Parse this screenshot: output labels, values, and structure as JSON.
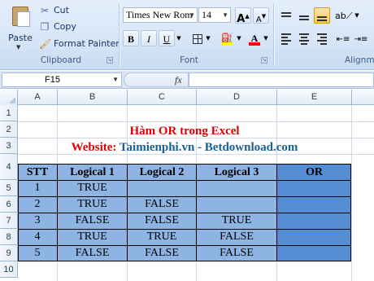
{
  "ribbon": {
    "clipboard": {
      "paste_label": "Paste",
      "cut_label": "Cut",
      "copy_label": "Copy",
      "format_painter_label": "Format Painter",
      "group_title": "Clipboard"
    },
    "font": {
      "font_name": "Times New Rom",
      "font_size": "14",
      "bold_label": "B",
      "italic_label": "I",
      "underline_label": "U",
      "font_color_label": "A",
      "grow_label": "A",
      "shrink_label": "A",
      "group_title": "Font",
      "highlight_color": "#ffff00",
      "font_color": "#ff0000"
    },
    "alignment": {
      "group_title": "Alignme"
    }
  },
  "formula_bar": {
    "name_box": "F15",
    "fx_label": "fx",
    "formula": ""
  },
  "sheet": {
    "columns": [
      "A",
      "B",
      "C",
      "D",
      "E"
    ],
    "rows": [
      "1",
      "2",
      "3",
      "4",
      "5",
      "6",
      "7",
      "8",
      "9",
      "10"
    ],
    "title": "Hàm OR trong Excel",
    "website_label": "Website:",
    "website_value": "Taimienphi.vn - Betdownload.com",
    "table_headers": [
      "STT",
      "Logical 1",
      "Logical 2",
      "Logical 3",
      "OR"
    ],
    "table_rows": [
      [
        "1",
        "TRUE",
        "",
        "",
        ""
      ],
      [
        "2",
        "TRUE",
        "FALSE",
        "",
        ""
      ],
      [
        "3",
        "FALSE",
        "FALSE",
        "TRUE",
        ""
      ],
      [
        "4",
        "TRUE",
        "TRUE",
        "FALSE",
        ""
      ],
      [
        "5",
        "FALSE",
        "FALSE",
        "FALSE",
        ""
      ]
    ],
    "table_fill_color": "#8eb4e3",
    "or_column_fill_color": "#538ed5"
  }
}
